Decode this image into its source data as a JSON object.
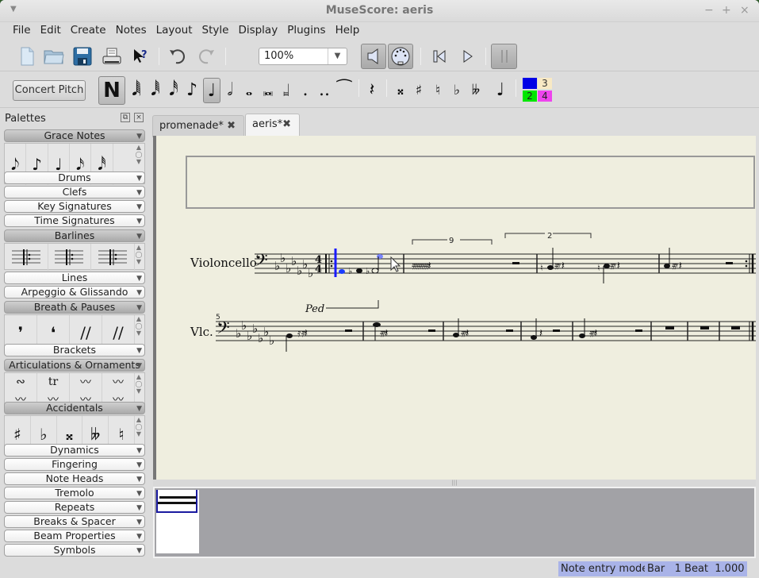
{
  "window": {
    "title": "MuseScore: aeris",
    "controls": {
      "minimize": "−",
      "maximize": "+",
      "close": "×"
    }
  },
  "menubar": [
    {
      "label": "File",
      "mnemonic": "F"
    },
    {
      "label": "Edit",
      "mnemonic": "E"
    },
    {
      "label": "Create",
      "mnemonic": "C"
    },
    {
      "label": "Notes",
      "mnemonic": "N"
    },
    {
      "label": "Layout",
      "mnemonic": "L"
    },
    {
      "label": "Style",
      "mnemonic": "S"
    },
    {
      "label": "Display",
      "mnemonic": "D"
    },
    {
      "label": "Plugins",
      "mnemonic": ""
    },
    {
      "label": "Help",
      "mnemonic": "H"
    }
  ],
  "toolbar": {
    "file_icons": [
      "new-file-icon",
      "open-folder-icon",
      "save-icon",
      "print-icon",
      "whats-this-icon"
    ],
    "edit_icons": [
      "undo-icon",
      "redo-icon"
    ],
    "zoom_value": "100%",
    "playback_icons": [
      "speaker-icon",
      "midi-input-icon",
      "rewind-icon",
      "play-icon",
      "repeat-pause-icon"
    ]
  },
  "note_toolbar": {
    "concert_pitch_label": "Concert Pitch",
    "note_entry_label": "N",
    "durations": [
      {
        "name": "64th-note",
        "glyph": "𝅘𝅥𝅲"
      },
      {
        "name": "32nd-note",
        "glyph": "𝅘𝅥𝅱"
      },
      {
        "name": "16th-note",
        "glyph": "𝅘𝅥𝅰"
      },
      {
        "name": "eighth-note",
        "glyph": "♪"
      },
      {
        "name": "quarter-note",
        "glyph": "♩",
        "active": true
      },
      {
        "name": "half-note",
        "glyph": "𝅗𝅥"
      },
      {
        "name": "whole-note",
        "glyph": "𝅝"
      },
      {
        "name": "breve",
        "glyph": "𝅜"
      },
      {
        "name": "longa",
        "glyph": "𝆷"
      },
      {
        "name": "dot",
        "glyph": "."
      },
      {
        "name": "double-dot",
        "glyph": ".."
      },
      {
        "name": "tie",
        "glyph": "⁀"
      },
      {
        "name": "rest",
        "glyph": "𝄽"
      }
    ],
    "accidentals": [
      {
        "name": "double-sharp",
        "glyph": "𝄪"
      },
      {
        "name": "sharp",
        "glyph": "♯"
      },
      {
        "name": "natural",
        "glyph": "♮"
      },
      {
        "name": "flat",
        "glyph": "♭"
      },
      {
        "name": "double-flat",
        "glyph": "𝄫"
      }
    ],
    "flip_glyph": "♩",
    "voices": [
      {
        "label": "1",
        "color": "#0000e6"
      },
      {
        "label": "3",
        "color": "#f8e9c4"
      },
      {
        "label": "2",
        "color": "#00e600"
      },
      {
        "label": "4",
        "color": "#ee44ee"
      }
    ]
  },
  "palettes": {
    "title": "Palettes",
    "sections": [
      {
        "label": "Grace Notes",
        "open": true,
        "items": [
          "𝅘𝅥𝅮",
          "♪",
          "♩",
          "𝅘𝅥𝅯",
          "𝅘𝅥𝅰"
        ]
      },
      {
        "label": "Drums",
        "open": false
      },
      {
        "label": "Clefs",
        "open": false
      },
      {
        "label": "Key Signatures",
        "open": false
      },
      {
        "label": "Time Signatures",
        "open": false
      },
      {
        "label": "Barlines",
        "open": true,
        "items": [
          "start-repeat",
          "end-repeat",
          "end-start-repeat"
        ]
      },
      {
        "label": "Lines",
        "open": false
      },
      {
        "label": "Arpeggio & Glissando",
        "open": false
      },
      {
        "label": "Breath & Pauses",
        "open": true,
        "items": [
          "❜",
          "❛",
          "//",
          "//"
        ]
      },
      {
        "label": "Brackets",
        "open": false
      },
      {
        "label": "Articulations & Ornaments",
        "open": true,
        "items": [
          "∾",
          "tr",
          "〰",
          "〰",
          "〰",
          "〰",
          "〰",
          "〰"
        ]
      },
      {
        "label": "Accidentals",
        "open": true,
        "items": [
          "♯",
          "♭",
          "𝄪",
          "𝄫",
          "♮"
        ]
      },
      {
        "label": "Dynamics",
        "open": false
      },
      {
        "label": "Fingering",
        "open": false
      },
      {
        "label": "Note Heads",
        "open": false
      },
      {
        "label": "Tremolo",
        "open": false
      },
      {
        "label": "Repeats",
        "open": false
      },
      {
        "label": "Breaks & Spacer",
        "open": false
      },
      {
        "label": "Beam Properties",
        "open": false
      },
      {
        "label": "Symbols",
        "open": false
      }
    ]
  },
  "tabs": [
    {
      "label": "promenade*",
      "active": false
    },
    {
      "label": "aeris*",
      "active": true
    }
  ],
  "score": {
    "system1": {
      "instrument": "Violoncello",
      "tuplet1": "9",
      "tuplet2": "2"
    },
    "system2": {
      "instrument": "Vlc.",
      "measure_number": "5",
      "pedal_text": "Ped"
    }
  },
  "status": {
    "mode": "Note entry mode",
    "position": "Bar   1 Beat  1.000"
  }
}
